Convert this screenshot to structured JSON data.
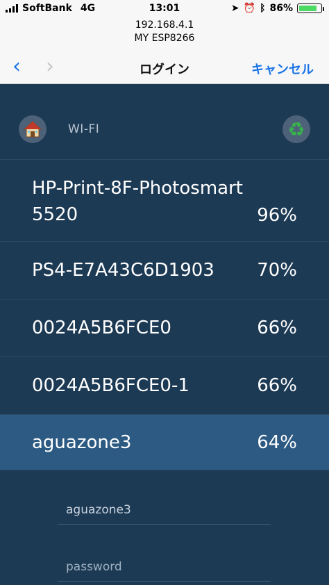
{
  "status": {
    "carrier": "SoftBank",
    "network": "4G",
    "time": "13:01",
    "battery": "86%",
    "battery_level": 0.86
  },
  "url": {
    "host": "192.168.4.1",
    "page_title": "MY ESP8266"
  },
  "nav": {
    "title": "ログイン",
    "cancel": "キャンセル"
  },
  "header": {
    "label": "WI-FI",
    "recycle_icon": "♻"
  },
  "networks": [
    {
      "ssid_line1": "HP-Print-8F-Photosmart",
      "ssid_line2": "5520",
      "signal": "96%"
    },
    {
      "ssid": "PS4-E7A43C6D1903",
      "signal": "70%"
    },
    {
      "ssid": "0024A5B6FCE0",
      "signal": "66%"
    },
    {
      "ssid": "0024A5B6FCE0-1",
      "signal": "66%"
    },
    {
      "ssid": "aguazone3",
      "signal": "64%",
      "selected": true
    }
  ],
  "form": {
    "ssid_value": "aguazone3",
    "password_placeholder": "password"
  }
}
